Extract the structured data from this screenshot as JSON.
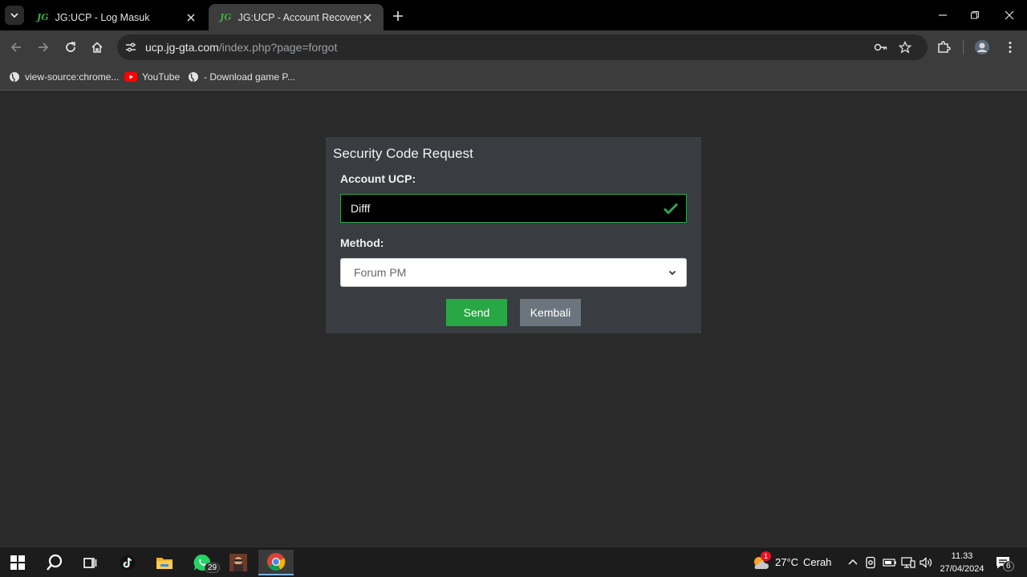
{
  "browser": {
    "tabs": [
      {
        "favicon": "JG",
        "title": "JG:UCP - Log Masuk",
        "active": false
      },
      {
        "favicon": "JG",
        "title": "JG:UCP - Account Recovery",
        "active": true
      }
    ],
    "address": {
      "host": "ucp.jg-gta.com",
      "path": "/index.php?page=forgot"
    },
    "bookmarks": [
      {
        "icon": "globe-icon",
        "label": "view-source:chrome..."
      },
      {
        "icon": "youtube-icon",
        "label": "YouTube"
      },
      {
        "icon": "globe-icon",
        "label": "- Download game P..."
      }
    ]
  },
  "form": {
    "title": "Security Code Request",
    "account_label": "Account UCP:",
    "account_value": "Difff",
    "method_label": "Method:",
    "method_value": "Forum PM",
    "send_label": "Send",
    "back_label": "Kembali"
  },
  "taskbar": {
    "whatsapp_badge": "29",
    "weather_badge": "1",
    "weather_temp": "27°C",
    "weather_desc": "Cerah",
    "time": "11.33",
    "date": "27/04/2024",
    "notification_count": "6"
  },
  "colors": {
    "accent_green": "#28a745",
    "secondary_gray": "#6c757d",
    "card_bg": "#393c40",
    "page_bg": "#2a2a2a"
  }
}
